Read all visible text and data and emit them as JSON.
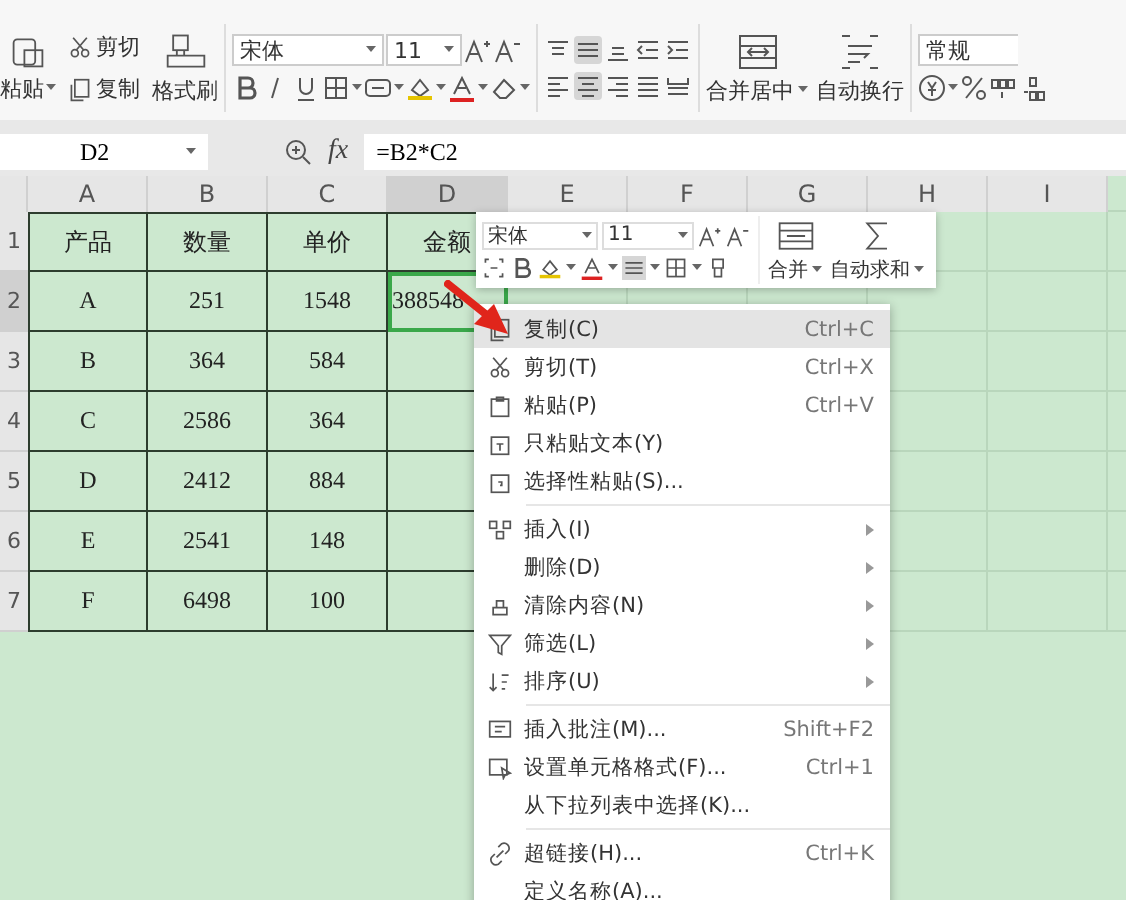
{
  "ribbon": {
    "paste": "粘贴",
    "cut": "剪切",
    "copy": "复制",
    "format_painter": "格式刷",
    "font": "宋体",
    "size": "11",
    "merge": "合并居中",
    "wrap": "自动换行",
    "number_format": "常规"
  },
  "formula_bar": {
    "cell": "D2",
    "fx_label": "fx",
    "formula": "=B2*C2"
  },
  "columns": [
    {
      "label": "A",
      "selected": false
    },
    {
      "label": "B",
      "selected": false
    },
    {
      "label": "C",
      "selected": false
    },
    {
      "label": "D",
      "selected": true
    },
    {
      "label": "E",
      "selected": false
    },
    {
      "label": "F",
      "selected": false
    },
    {
      "label": "G",
      "selected": false
    },
    {
      "label": "H",
      "selected": false
    },
    {
      "label": "I",
      "selected": false
    }
  ],
  "rows": [
    {
      "header": "1",
      "selected": false,
      "cells": [
        "产品",
        "数量",
        "单价",
        "金额"
      ]
    },
    {
      "header": "2",
      "selected": true,
      "cells": [
        "A",
        "251",
        "1548",
        "388548"
      ]
    },
    {
      "header": "3",
      "selected": false,
      "cells": [
        "B",
        "364",
        "584",
        ""
      ]
    },
    {
      "header": "4",
      "selected": false,
      "cells": [
        "C",
        "2586",
        "364",
        ""
      ]
    },
    {
      "header": "5",
      "selected": false,
      "cells": [
        "D",
        "2412",
        "884",
        ""
      ]
    },
    {
      "header": "6",
      "selected": false,
      "cells": [
        "E",
        "2541",
        "148",
        ""
      ]
    },
    {
      "header": "7",
      "selected": false,
      "cells": [
        "F",
        "6498",
        "100",
        ""
      ]
    }
  ],
  "mini_toolbar": {
    "font": "宋体",
    "size": "11",
    "merge": "合并",
    "autosum": "自动求和"
  },
  "context_menu": [
    {
      "kind": "item",
      "label": "复制(C)",
      "shortcut": "Ctrl+C",
      "submenu": false,
      "selected": true
    },
    {
      "kind": "item",
      "label": "剪切(T)",
      "shortcut": "Ctrl+X",
      "submenu": false,
      "selected": false
    },
    {
      "kind": "item",
      "label": "粘贴(P)",
      "shortcut": "Ctrl+V",
      "submenu": false,
      "selected": false
    },
    {
      "kind": "item",
      "label": "只粘贴文本(Y)",
      "submenu": false,
      "selected": false
    },
    {
      "kind": "item",
      "label": "选择性粘贴(S)...",
      "submenu": false,
      "selected": false
    },
    {
      "kind": "separator"
    },
    {
      "kind": "item",
      "label": "插入(I)",
      "submenu": true,
      "selected": false
    },
    {
      "kind": "item",
      "label": "删除(D)",
      "submenu": true,
      "selected": false
    },
    {
      "kind": "item",
      "label": "清除内容(N)",
      "submenu": true,
      "selected": false
    },
    {
      "kind": "item",
      "label": "筛选(L)",
      "submenu": true,
      "selected": false
    },
    {
      "kind": "item",
      "label": "排序(U)",
      "submenu": true,
      "selected": false
    },
    {
      "kind": "separator"
    },
    {
      "kind": "item",
      "label": "插入批注(M)...",
      "shortcut": "Shift+F2",
      "submenu": false,
      "selected": false
    },
    {
      "kind": "item",
      "label": "设置单元格格式(F)...",
      "shortcut": "Ctrl+1",
      "submenu": false,
      "selected": false
    },
    {
      "kind": "item",
      "label": "从下拉列表中选择(K)...",
      "submenu": false,
      "selected": false
    },
    {
      "kind": "separator"
    },
    {
      "kind": "item",
      "label": "超链接(H)...",
      "shortcut": "Ctrl+K",
      "submenu": false,
      "selected": false
    },
    {
      "kind": "item",
      "label": "定义名称(A)...",
      "submenu": false,
      "selected": false
    }
  ]
}
